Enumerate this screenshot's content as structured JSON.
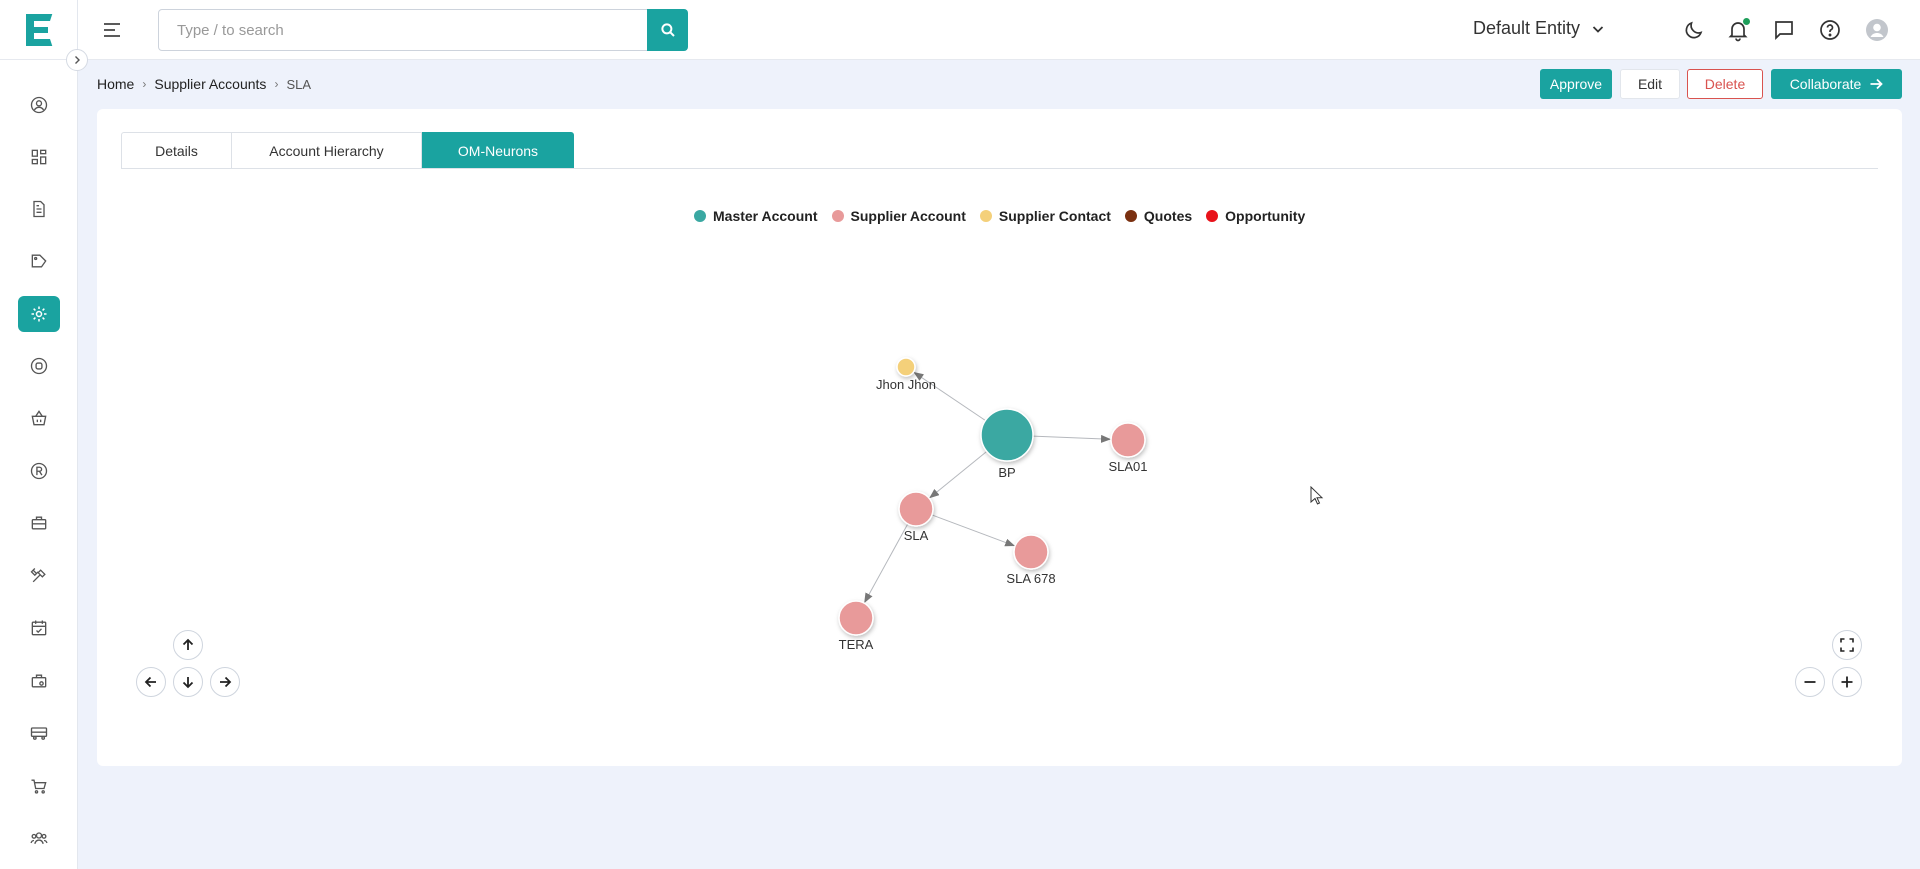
{
  "app": {
    "logo_letter": "E"
  },
  "search": {
    "placeholder": "Type / to search"
  },
  "header": {
    "entity": "Default Entity"
  },
  "breadcrumb": {
    "items": [
      "Home",
      "Supplier Accounts",
      "SLA"
    ]
  },
  "actions": {
    "approve": "Approve",
    "edit": "Edit",
    "delete": "Delete",
    "collaborate": "Collaborate"
  },
  "tabs": [
    {
      "label": "Details",
      "active": false
    },
    {
      "label": "Account Hierarchy",
      "active": false
    },
    {
      "label": "OM-Neurons",
      "active": true
    }
  ],
  "legend": [
    {
      "label": "Master Account",
      "color": "#3aa8a2"
    },
    {
      "label": "Supplier Account",
      "color": "#e89a9a"
    },
    {
      "label": "Supplier Contact",
      "color": "#f4d07a"
    },
    {
      "label": "Quotes",
      "color": "#7a3010"
    },
    {
      "label": "Opportunity",
      "color": "#e8121a"
    }
  ],
  "graph": {
    "nodes": [
      {
        "id": "BP",
        "label": "BP",
        "type": "Master Account"
      },
      {
        "id": "JJ",
        "label": "Jhon Jhon",
        "type": "Supplier Contact"
      },
      {
        "id": "SLA01",
        "label": "SLA01",
        "type": "Supplier Account"
      },
      {
        "id": "SLA",
        "label": "SLA",
        "type": "Supplier Account"
      },
      {
        "id": "SLA678",
        "label": "SLA 678",
        "type": "Supplier Account"
      },
      {
        "id": "TERA",
        "label": "TERA",
        "type": "Supplier Account"
      }
    ],
    "edges": [
      {
        "from": "BP",
        "to": "JJ"
      },
      {
        "from": "BP",
        "to": "SLA01"
      },
      {
        "from": "BP",
        "to": "SLA"
      },
      {
        "from": "SLA",
        "to": "SLA678"
      },
      {
        "from": "SLA",
        "to": "TERA"
      }
    ]
  },
  "colors": {
    "accent": "#1aa3a0",
    "danger": "#d9534f"
  }
}
